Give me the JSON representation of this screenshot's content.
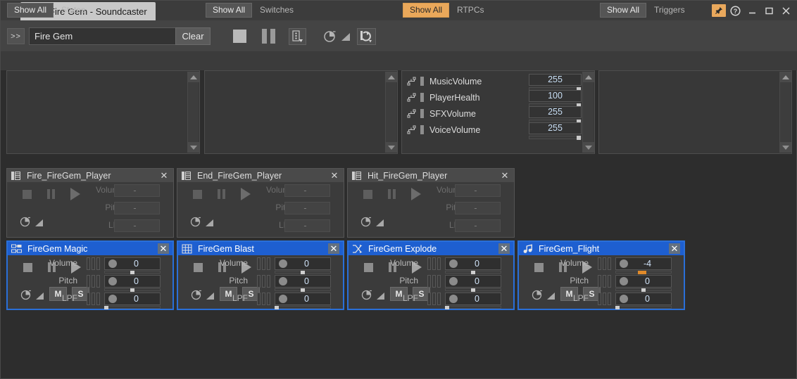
{
  "window": {
    "tab_title": "Fire Gem - Soundcaster",
    "tab_icon": "soundcaster-icon",
    "pin_label": "✓",
    "help_label": "?",
    "minimize_label": "–",
    "maximize_label": "☐",
    "close_label": "✕",
    "accent_orange": "#eaa85a",
    "accent_blue": "#2a6fd8"
  },
  "toolbar": {
    "expand_label": ">>",
    "search_value": "Fire Gem",
    "search_placeholder": "Search",
    "clear_label": "Clear",
    "stop_name": "stop-button",
    "pause_name": "pause-button",
    "options_name": "options-dropdown-button",
    "delay_name": "delay-icon",
    "ramp_name": "ramp-icon",
    "reset_name": "reset-button"
  },
  "filters": [
    {
      "button": "Show All",
      "label": "States",
      "active": false
    },
    {
      "button": "Show All",
      "label": "Switches",
      "active": false
    },
    {
      "button": "Show All",
      "label": "RTPCs",
      "active": true
    },
    {
      "button": "Show All",
      "label": "Triggers",
      "active": false
    }
  ],
  "rtpcs": [
    {
      "name": "MusicVolume",
      "value": "255",
      "pct": 100
    },
    {
      "name": "PlayerHealth",
      "value": "100",
      "pct": 100
    },
    {
      "name": "SFXVolume",
      "value": "255",
      "pct": 100
    },
    {
      "name": "VoiceVolume",
      "value": "255",
      "pct": 100
    }
  ],
  "states_items": [],
  "switches_items": [],
  "triggers_items": [],
  "param_labels": {
    "volume": "Volume",
    "pitch": "Pitch",
    "lpf": "LPF"
  },
  "mute_label": "M",
  "solo_label": "S",
  "close_label": "✕",
  "sound_panels": [
    {
      "title": "Fire_FireGem_Player",
      "icon": "sound-sfx-icon",
      "selected": false,
      "has_ms": false,
      "volume": "-",
      "pitch": "-",
      "lpf": "-",
      "volume_pct": 0,
      "pitch_pct": 0,
      "lpf_pct": 0,
      "volume_orange": false
    },
    {
      "title": "End_FireGem_Player",
      "icon": "sound-sfx-icon",
      "selected": false,
      "has_ms": false,
      "volume": "-",
      "pitch": "-",
      "lpf": "-",
      "volume_pct": 0,
      "pitch_pct": 0,
      "lpf_pct": 0,
      "volume_orange": false
    },
    {
      "title": "Hit_FireGem_Player",
      "icon": "sound-sfx-icon",
      "selected": false,
      "has_ms": false,
      "volume": "-",
      "pitch": "-",
      "lpf": "-",
      "volume_pct": 0,
      "pitch_pct": 0,
      "lpf_pct": 0,
      "volume_orange": false
    },
    {
      "title": "FireGem Magic",
      "icon": "event-icon",
      "selected": true,
      "has_ms": true,
      "volume": "0",
      "pitch": "0",
      "lpf": "0",
      "volume_pct": 50,
      "pitch_pct": 50,
      "lpf_pct": 2,
      "volume_orange": false
    },
    {
      "title": "FireGem Blast",
      "icon": "blend-container-icon",
      "selected": true,
      "has_ms": true,
      "volume": "0",
      "pitch": "0",
      "lpf": "0",
      "volume_pct": 50,
      "pitch_pct": 50,
      "lpf_pct": 2,
      "volume_orange": false
    },
    {
      "title": "FireGem Explode",
      "icon": "random-container-icon",
      "selected": true,
      "has_ms": true,
      "volume": "0",
      "pitch": "0",
      "lpf": "0",
      "volume_pct": 50,
      "pitch_pct": 50,
      "lpf_pct": 2,
      "volume_orange": false
    },
    {
      "title": "FireGem_Flight",
      "icon": "music-segment-icon",
      "selected": true,
      "has_ms": true,
      "volume": "-4",
      "pitch": "0",
      "lpf": "0",
      "volume_pct": 44,
      "pitch_pct": 50,
      "lpf_pct": 2,
      "volume_orange": true
    }
  ]
}
